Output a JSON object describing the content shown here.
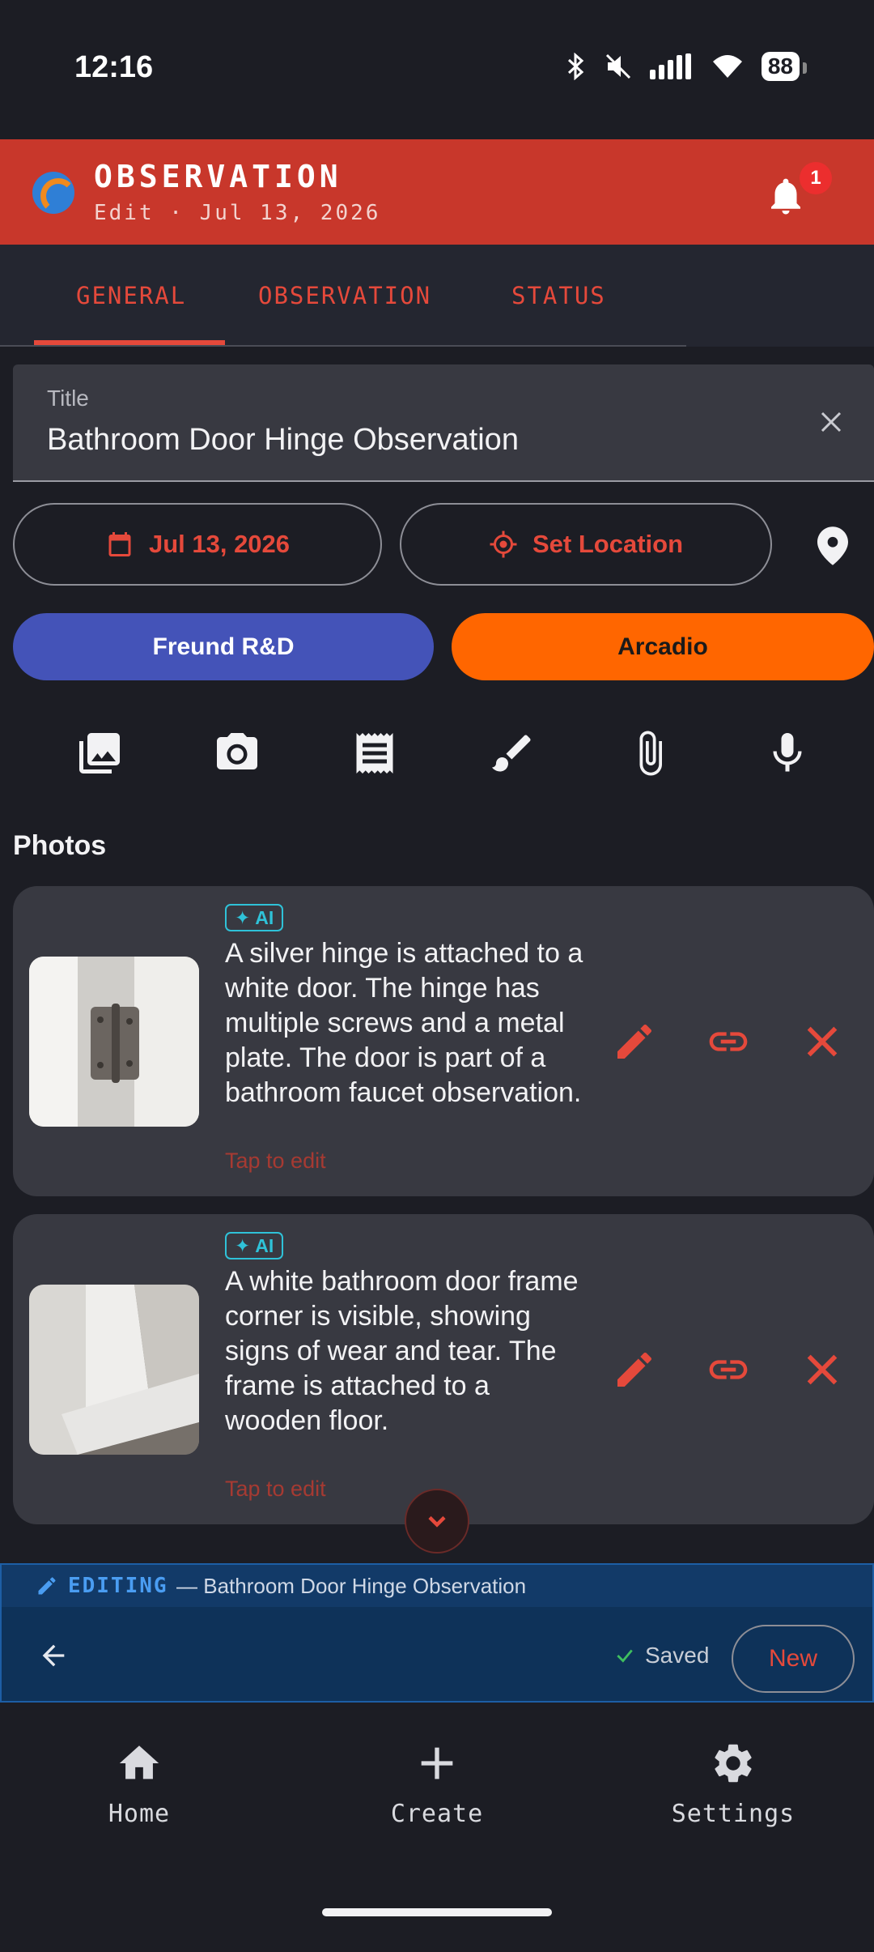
{
  "status_bar": {
    "time": "12:16",
    "battery": "88",
    "icons": [
      "bluetooth-icon",
      "mute-icon",
      "signal-icon",
      "wifi-icon",
      "battery-icon"
    ]
  },
  "header": {
    "title": "OBSERVATION",
    "subtitle": "Edit  ·  Jul 13, 2026",
    "notification_count": "1",
    "accent_color": "#c8372b"
  },
  "tabs": [
    {
      "label": "GENERAL",
      "active": true
    },
    {
      "label": "OBSERVATION",
      "active": false
    },
    {
      "label": "STATUS",
      "active": false
    }
  ],
  "form": {
    "title_label": "Title",
    "title_value": "Bathroom Door Hinge Observation",
    "date_label": "Jul 13, 2026",
    "location_label": "Set Location"
  },
  "tags": [
    {
      "label": "Freund R&D",
      "color": "#3f51b5"
    },
    {
      "label": "Arcadio",
      "color": "#ff6600"
    }
  ],
  "toolbar": {
    "icons": [
      "gallery-icon",
      "camera-icon",
      "receipt-icon",
      "brush-icon",
      "attachment-icon",
      "microphone-icon"
    ]
  },
  "photos": {
    "section_title": "Photos",
    "items": [
      {
        "ai_label": "AI",
        "caption": "A silver hinge is attached to a white door. The hinge has multiple screws and a metal plate. The door is part of a bathroom faucet observation.",
        "hint": "Tap to edit"
      },
      {
        "ai_label": "AI",
        "caption": "A white bathroom door frame corner is visible, showing signs of wear and tear. The frame is attached to a wooden floor.",
        "hint": "Tap to edit"
      }
    ]
  },
  "editing_bar": {
    "tag": "EDITING",
    "name": "— Bathroom Door Hinge Observation",
    "saved_label": "Saved",
    "new_label": "New"
  },
  "bottom_nav": [
    {
      "label": "Home",
      "icon": "home-icon"
    },
    {
      "label": "Create",
      "icon": "plus-icon"
    },
    {
      "label": "Settings",
      "icon": "gear-icon"
    }
  ]
}
